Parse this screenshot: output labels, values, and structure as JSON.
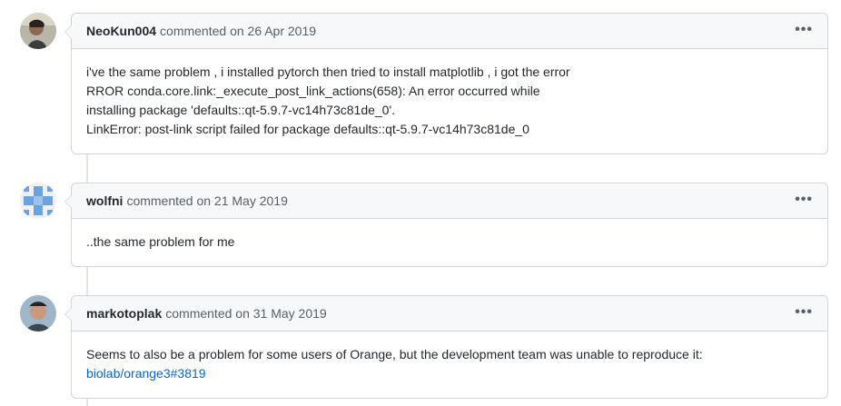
{
  "comments": [
    {
      "author": "NeoKun004",
      "meta": "commented on 26 Apr 2019",
      "avatar_icon": "user-photo-avatar",
      "lines": [
        "i've the same problem , i installed pytorch then tried to install matplotlib , i got the error",
        "RROR conda.core.link:_execute_post_link_actions(658): An error occurred while",
        "installing package 'defaults::qt-5.9.7-vc14h73c81de_0'.",
        "LinkError: post-link script failed for package defaults::qt-5.9.7-vc14h73c81de_0"
      ],
      "menu": "•••"
    },
    {
      "author": "wolfni",
      "meta": "commented on 21 May 2019",
      "avatar_icon": "identicon-avatar",
      "lines": [
        "..the same problem for me"
      ],
      "menu": "•••"
    },
    {
      "author": "markotoplak",
      "meta": "commented on 31 May 2019",
      "avatar_icon": "user-photo-avatar",
      "lines": [
        "Seems to also be a problem for some users of Orange, but the development team was unable to reproduce it:"
      ],
      "link": "biolab/orange3#3819",
      "menu": "•••"
    }
  ],
  "colors": {
    "link": "#0366d6",
    "header_bg": "#f6f8fa",
    "border": "#d1d5da",
    "identicon": "#6ba3e0"
  }
}
